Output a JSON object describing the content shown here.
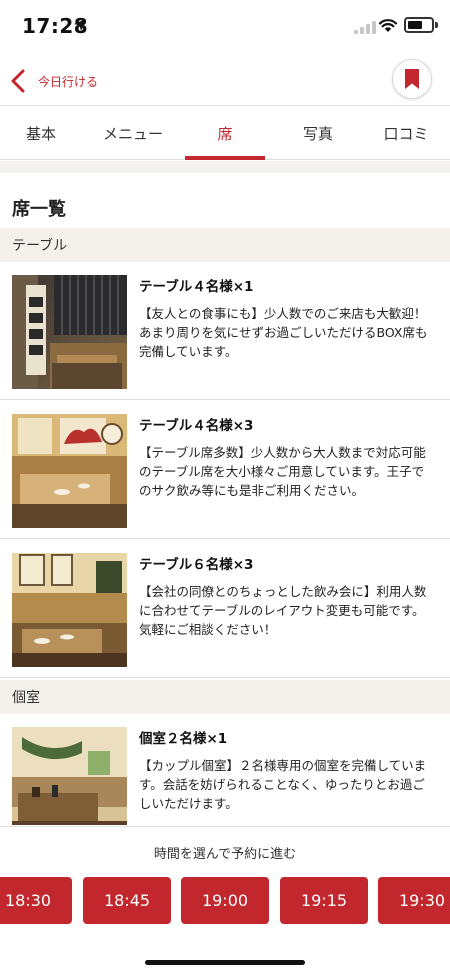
{
  "status_bar": {
    "time": "17:28"
  },
  "nav": {
    "back_label": "今日行ける"
  },
  "tabs": [
    {
      "label": "基本"
    },
    {
      "label": "メニュー"
    },
    {
      "label": "席"
    },
    {
      "label": "写真"
    },
    {
      "label": "口コミ"
    }
  ],
  "active_tab": "席",
  "section_title": "席一覧",
  "categories": [
    {
      "label": "テーブル"
    },
    {
      "label": "個室"
    }
  ],
  "seats": [
    {
      "name": "テーブル４名様×1",
      "desc": "【友人との食事にも】少人数でのご来店も大歓迎！あまり周りを気にせずお過ごしいただけるBOX席も完備しています。"
    },
    {
      "name": "テーブル４名様×3",
      "desc": "【テーブル席多数】少人数から大人数まで対応可能のテーブル席を大小様々ご用意しています。王子でのサク飲み等にも是非ご利用ください。"
    },
    {
      "name": "テーブル６名様×3",
      "desc": "【会社の同僚とのちょっとした飲み会に】利用人数に合わせてテーブルのレイアウト変更も可能です。気軽にご相談ください！"
    },
    {
      "name": "個室２名様×1",
      "desc": "【カップル個室】２名様専用の個室を完備しています。会話を妨げられることなく、ゆったりとお過ごしいただけます。"
    }
  ],
  "reservation": {
    "label": "時間を選んで予約に進む",
    "times": [
      "18:30",
      "18:45",
      "19:00",
      "19:15",
      "19:30"
    ]
  },
  "colors": {
    "accent": "#c1272d",
    "category_bg": "#f4f1ec"
  }
}
